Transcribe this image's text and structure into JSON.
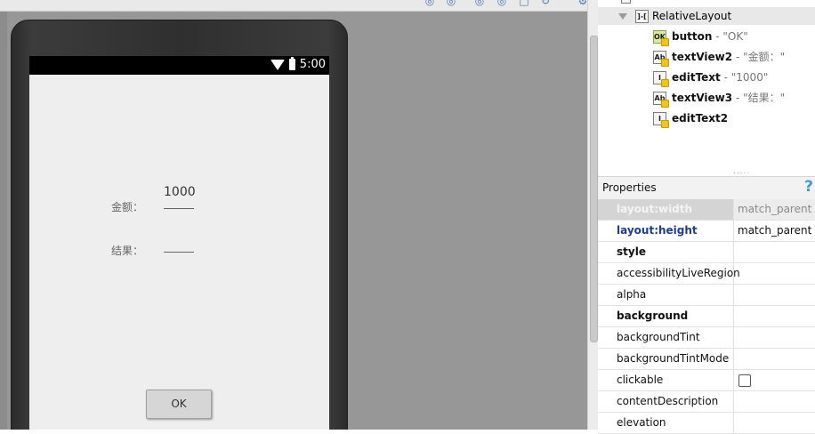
{
  "canvas": {
    "status_bar": {
      "time": "5:00"
    },
    "app": {
      "amount_label": "金额：",
      "amount_value": "1000",
      "result_label": "结果：",
      "result_value": "",
      "ok_button": "OK"
    }
  },
  "component_tree": {
    "root": {
      "name": "RelativeLayout",
      "icon": "relative-layout-icon"
    },
    "children": [
      {
        "name": "button",
        "sep": " - ",
        "detail": "\"OK\"",
        "icon": "ok-button-icon"
      },
      {
        "name": "textView2",
        "sep": " - ",
        "detail": "\"金额：\"",
        "icon": "textview-icon"
      },
      {
        "name": "editText",
        "sep": " - ",
        "detail": "\"1000\"",
        "icon": "edittext-icon"
      },
      {
        "name": "textView3",
        "sep": " - ",
        "detail": "\"结果：\"",
        "icon": "textview-icon"
      },
      {
        "name": "editText2",
        "sep": "",
        "detail": "",
        "icon": "edittext-icon"
      }
    ],
    "icon_text": {
      "ok": "OK",
      "textview": "Ab",
      "edittext": "I"
    },
    "dots": "....."
  },
  "properties": {
    "title": "Properties",
    "help": "?",
    "rows": [
      {
        "name": "layout:width",
        "value": "match_parent"
      },
      {
        "name": "layout:height",
        "value": "match_parent"
      },
      {
        "name": "style",
        "value": ""
      },
      {
        "name": "accessibilityLiveRegion",
        "value": ""
      },
      {
        "name": "alpha",
        "value": ""
      },
      {
        "name": "background",
        "value": ""
      },
      {
        "name": "backgroundTint",
        "value": ""
      },
      {
        "name": "backgroundTintMode",
        "value": ""
      },
      {
        "name": "clickable",
        "value": ""
      },
      {
        "name": "contentDescription",
        "value": ""
      },
      {
        "name": "elevation",
        "value": ""
      }
    ]
  },
  "colors": {
    "canvas_bg": "#979797",
    "screen_bg": "#eeeeee",
    "selected_prop_name": "#1e3d8f",
    "help_icon": "#3a9ad6"
  }
}
